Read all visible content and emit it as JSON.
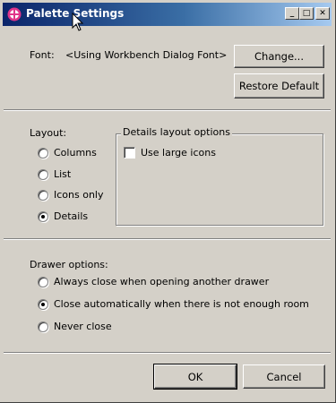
{
  "window": {
    "title": "Palette Settings",
    "min_glyph": "_",
    "max_glyph": "□",
    "close_glyph": "✕"
  },
  "font": {
    "label": "Font:",
    "value": "<Using Workbench Dialog Font>",
    "change_label": "Change...",
    "restore_label": "Restore Default"
  },
  "layout": {
    "label": "Layout:",
    "options": [
      {
        "label": "Columns",
        "selected": false
      },
      {
        "label": "List",
        "selected": false
      },
      {
        "label": "Icons only",
        "selected": false
      },
      {
        "label": "Details",
        "selected": true
      }
    ],
    "details_group": {
      "title": "Details layout options",
      "large_icons_label": "Use large icons",
      "large_icons_checked": false
    }
  },
  "drawer": {
    "label": "Drawer options:",
    "options": [
      {
        "label": "Always close when opening another drawer",
        "selected": false
      },
      {
        "label": "Close automatically when there is not enough room",
        "selected": true
      },
      {
        "label": "Never close",
        "selected": false
      }
    ]
  },
  "footer": {
    "ok_label": "OK",
    "cancel_label": "Cancel"
  }
}
